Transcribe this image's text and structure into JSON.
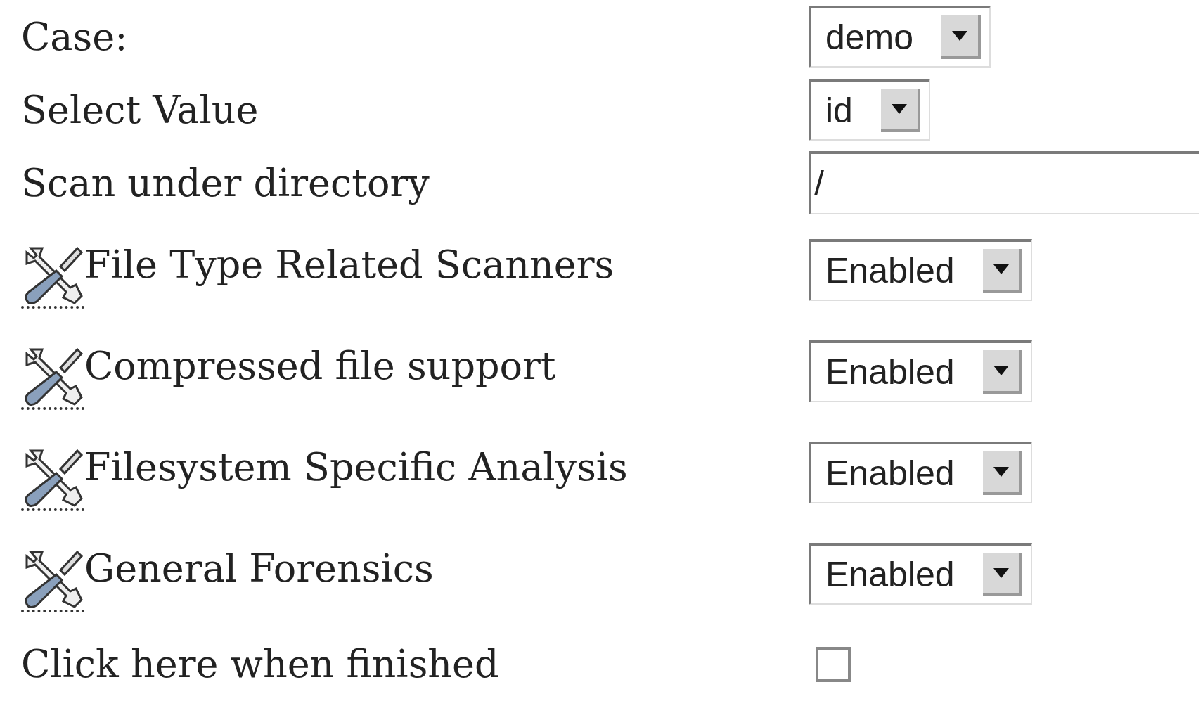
{
  "fields": [
    {
      "kind": "select",
      "label": "Case:",
      "value": "demo"
    },
    {
      "kind": "select",
      "label": "Select Value",
      "value": "id"
    },
    {
      "kind": "text",
      "label": "Scan under directory",
      "value": "/"
    }
  ],
  "scanners": [
    {
      "label": "File Type Related Scanners",
      "value": "Enabled"
    },
    {
      "label": "Compressed file support",
      "value": "Enabled"
    },
    {
      "label": "Filesystem Specific Analysis",
      "value": "Enabled"
    },
    {
      "label": "General Forensics",
      "value": "Enabled"
    }
  ],
  "finish": {
    "label": "Click here when finished",
    "checked": false
  }
}
